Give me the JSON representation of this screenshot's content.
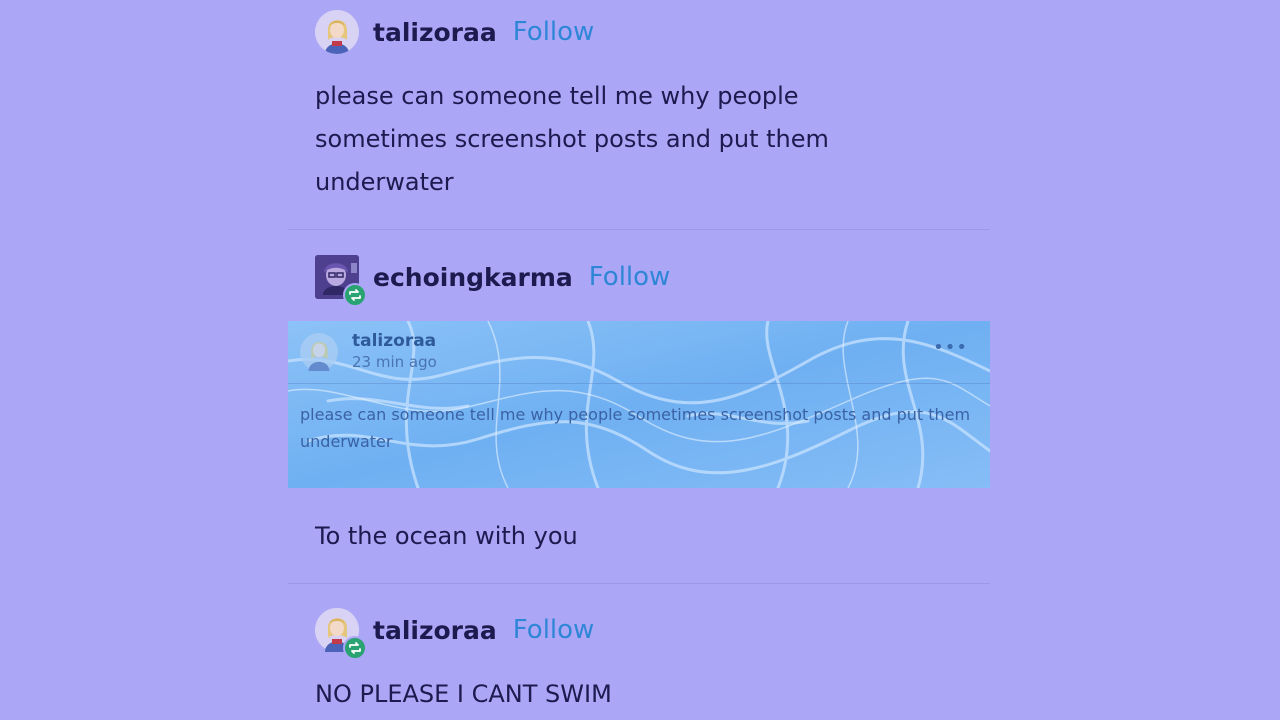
{
  "colors": {
    "background": "#aba7f6",
    "text": "#1c1a4f",
    "follow": "#2f86d6",
    "reblog_badge": "#2aa372"
  },
  "posts": [
    {
      "username": "talizoraa",
      "follow_label": "Follow",
      "avatar_icon": "avatar-anime-girl-icon",
      "text": "please can someone tell me why people sometimes screenshot posts and put them underwater"
    },
    {
      "username": "echoingkarma",
      "follow_label": "Follow",
      "avatar_icon": "avatar-purple-character-icon",
      "reblog_icon": "reblog-icon",
      "embedded": {
        "username": "talizoraa",
        "time": "23 min ago",
        "more_icon": "more-dots-icon",
        "text": "please can someone tell me why people sometimes screenshot posts and put them underwater"
      },
      "text": "To the ocean with you"
    },
    {
      "username": "talizoraa",
      "follow_label": "Follow",
      "avatar_icon": "avatar-anime-girl-icon",
      "reblog_icon": "reblog-icon",
      "text": "NO PLEASE I CANT SWIM"
    }
  ]
}
